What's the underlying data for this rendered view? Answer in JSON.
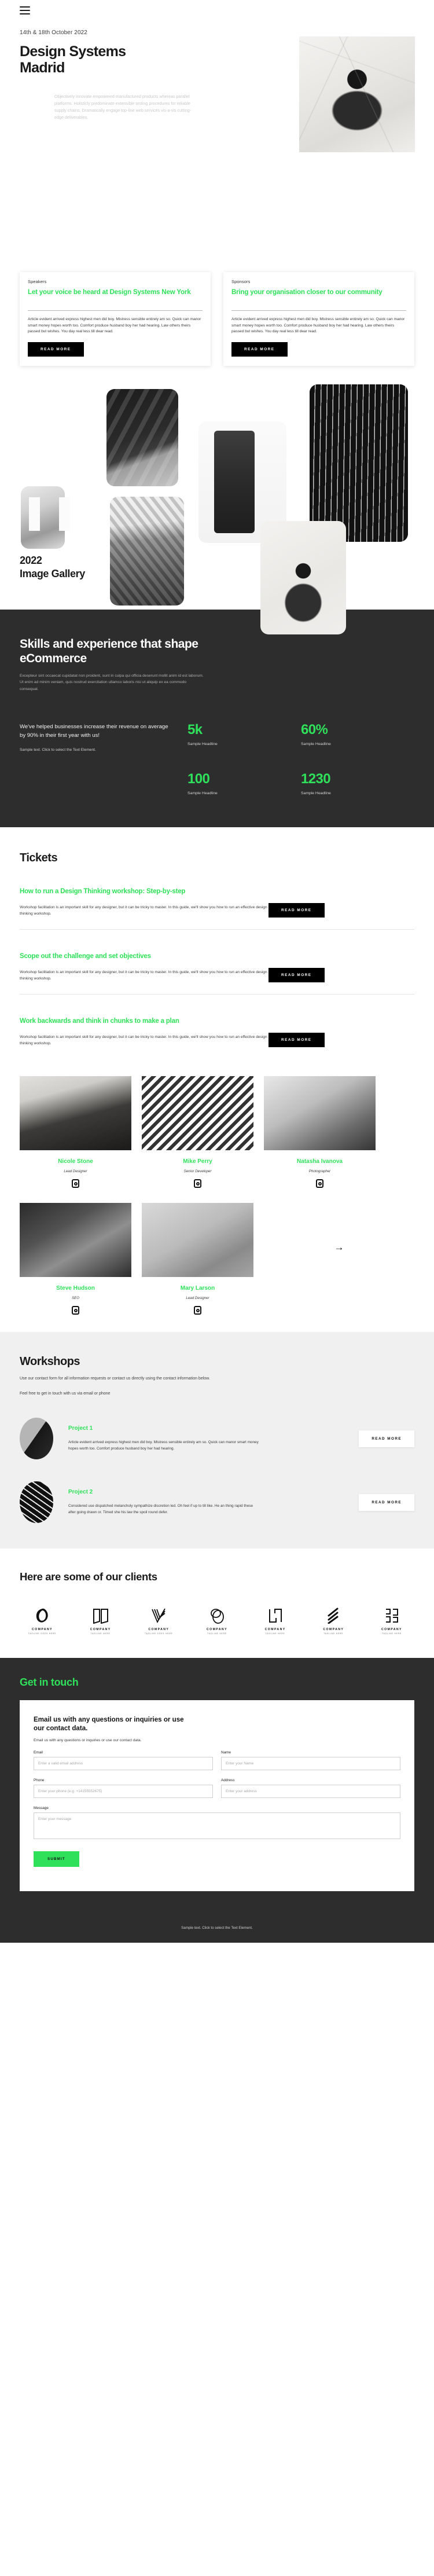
{
  "header": {
    "menu_icon": "hamburger-icon"
  },
  "hero": {
    "date": "14th & 18th October 2022",
    "title": "Design Systems Madrid",
    "paragraph": "Objectively innovate empowered manufactured products whereas parallel platforms. Holisticly predominate extensible testing procedures for reliable supply chains. Dramatically engage top-line web services vis-a-vis cutting-edge deliverables."
  },
  "cards": [
    {
      "kicker": "Speakers",
      "title": "Let your voice be heard at Design Systems New York",
      "body": "Article evident arrived express highest men did boy. Mistress sensible entirely am so. Quick can manor smart money hopes worth too. Comfort produce husband boy her had hearing. Law others theirs passed but wishes. You day real less till dear read.",
      "button": "READ MORE"
    },
    {
      "kicker": "Sponsors",
      "title": "Bring your organisation closer to our community",
      "body": "Article evident arrived express highest men did boy. Mistress sensible entirely am so. Quick can manor smart money hopes worth too. Comfort produce husband boy her had hearing. Law others theirs passed but wishes. You day real less till dear read.",
      "button": "READ MORE"
    }
  ],
  "gallery": {
    "year": "2022",
    "name": "Image Gallery"
  },
  "skills": {
    "title": "Skills and experience that shape eCommerce",
    "paragraph": "Excepteur sint occaecat cupidatat non proident, sunt in culpa qui officia deserunt mollit anim id est laborum. Ut enim ad minim veniam, quis nostrud exercitation ullamco laboris nisi ut aliquip ex ea commodo consequat.",
    "lead": "We've helped businesses increase their revenue on average by 90% in their first year with us!",
    "sub": "Sample text. Click to select the Text Element.",
    "stats": [
      {
        "value": "5k",
        "caption": "Sample Headline"
      },
      {
        "value": "60%",
        "caption": "Sample Headline"
      },
      {
        "value": "100",
        "caption": "Sample Headline"
      },
      {
        "value": "1230",
        "caption": "Sample Headline"
      }
    ]
  },
  "tickets": {
    "title": "Tickets",
    "items": [
      {
        "heading": "How to run a Design Thinking workshop: Step-by-step",
        "body": "Workshop facilitation is an important skill for any designer, but it can be tricky to master. In this guide, we'll show you how to run an effective design thinking workshop.",
        "button": "READ MORE"
      },
      {
        "heading": "Scope out the challenge and set objectives",
        "body": "Workshop facilitation is an important skill for any designer, but it can be tricky to master. In this guide, we'll show you how to run an effective design thinking workshop.",
        "button": "READ MORE"
      },
      {
        "heading": "Work backwards and think in chunks to make a plan",
        "body": "Workshop facilitation is an important skill for any designer, but it can be tricky to master. In this guide, we'll show you how to run an effective design thinking workshop.",
        "button": "READ MORE"
      }
    ]
  },
  "team": {
    "members": [
      {
        "name": "Nicole Stone",
        "role": "Lead Designer",
        "social": "instagram-icon"
      },
      {
        "name": "Mike Perry",
        "role": "Senior Developer",
        "social": "instagram-icon"
      },
      {
        "name": "Natasha Ivanova",
        "role": "Photographer",
        "social": "instagram-icon"
      },
      {
        "name": "Steve Hudson",
        "role": "SEO",
        "social": "instagram-icon"
      },
      {
        "name": "Mary Larson",
        "role": "Lead Designer",
        "social": "instagram-icon"
      }
    ],
    "next_arrow": "→"
  },
  "workshops": {
    "title": "Workshops",
    "paragraph": "Use our contact form for all information requests or contact us directly using the contact information below.",
    "paragraph2": "Feel free to get in touch with us via email or phone",
    "projects": [
      {
        "title": "Project 1",
        "body": "Article evident arrived express highest men did boy. Mistress sensible entirely am so. Quick can manor smart money hopes worth too. Comfort produce husband boy her had hearing.",
        "button": "READ MORE"
      },
      {
        "title": "Project 2",
        "body": "Considered use dispatched melancholy sympathize discretion led. Oh feel if up to till like. He an thing rapid these after going drawn or. Timed she his law the spoil round defer.",
        "button": "READ MORE"
      }
    ]
  },
  "clients": {
    "title": "Here are some of our clients",
    "logos": [
      {
        "name": "COMPANY",
        "tagline": "TAGLINE GOES HERE",
        "mark": "ring-logo-icon"
      },
      {
        "name": "COMPANY",
        "tagline": "TAGLINE HERE",
        "mark": "book-logo-icon"
      },
      {
        "name": "COMPANY",
        "tagline": "TAGLINE GOES HERE",
        "mark": "chevron-lines-logo-icon"
      },
      {
        "name": "COMPANY",
        "tagline": "TAGLINE HERE",
        "mark": "overlap-circles-logo-icon"
      },
      {
        "name": "COMPANY",
        "tagline": "TAGLINE HERE",
        "mark": "squares-logo-icon"
      },
      {
        "name": "COMPANY",
        "tagline": "TAGLINE HERE",
        "mark": "slash-lines-logo-icon"
      },
      {
        "name": "COMPANY",
        "tagline": "TAGLINE HERE",
        "mark": "bracket-blocks-logo-icon"
      }
    ]
  },
  "contact": {
    "title": "Get in touch",
    "form_title": "Email us with any questions or inquiries or use our contact data.",
    "form_sub": "Email us with any questions or inquiries or use our contact data.",
    "fields": {
      "email_label": "Email",
      "email_placeholder": "Enter a valid email address",
      "name_label": "Name",
      "name_placeholder": "Enter your Name",
      "phone_label": "Phone",
      "phone_placeholder": "Enter your phone (e.g. +14155552675)",
      "address_label": "Address",
      "address_placeholder": "Enter your address",
      "message_label": "Message",
      "message_placeholder": "Enter your message"
    },
    "submit": "SUBMIT"
  },
  "footer": {
    "note": "Sample text. Click to select the Text Element."
  }
}
